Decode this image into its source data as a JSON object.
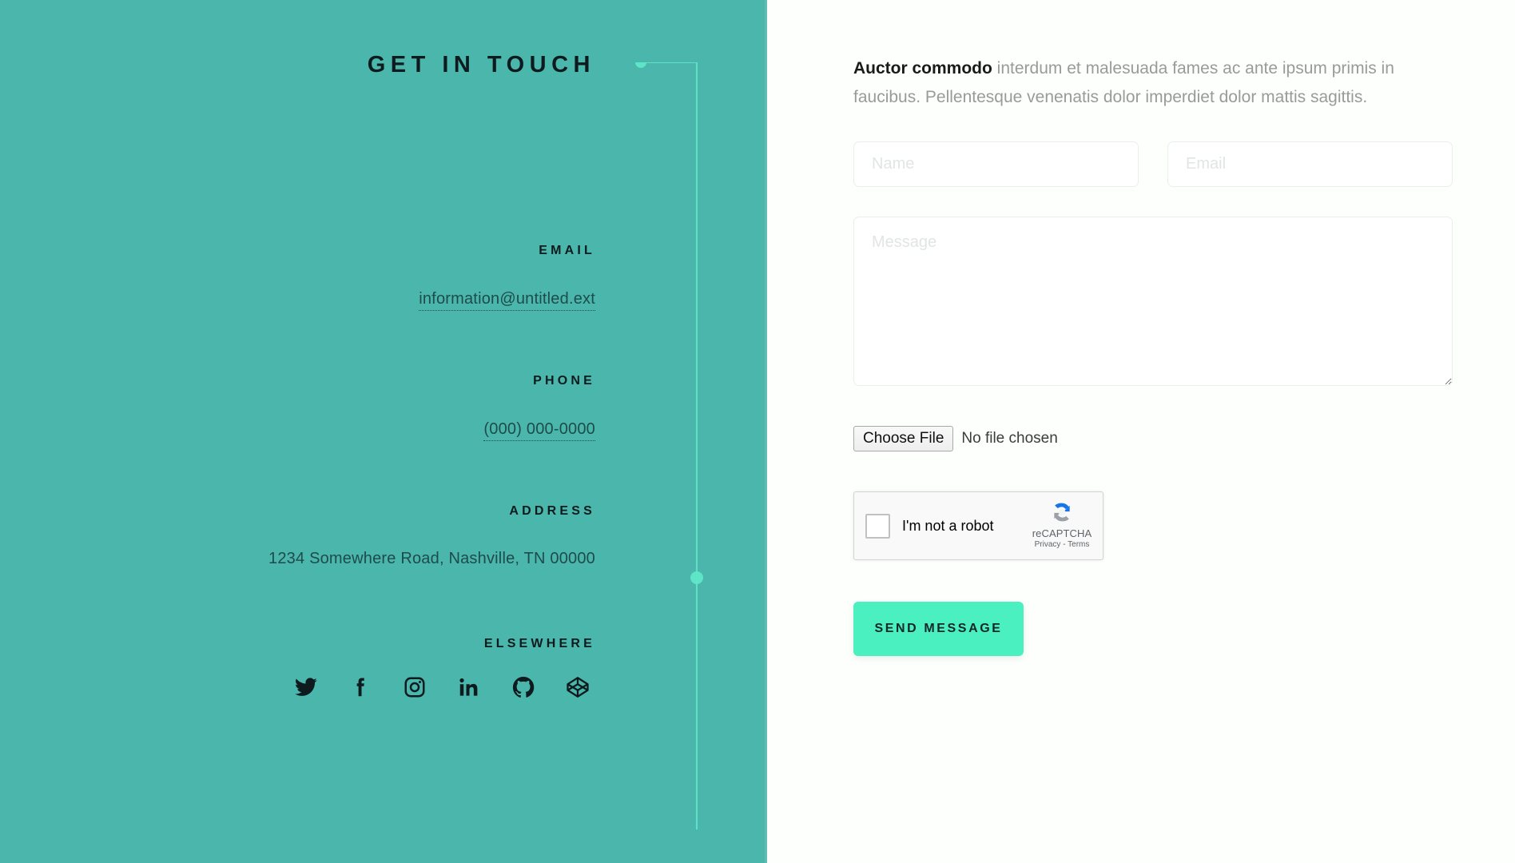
{
  "left": {
    "title": "GET IN TOUCH",
    "sections": [
      {
        "label": "EMAIL",
        "value": "information@untitled.ext",
        "link": true
      },
      {
        "label": "PHONE",
        "value": "(000) 000-0000",
        "link": true
      },
      {
        "label": "ADDRESS",
        "value": "1234 Somewhere Road, Nashville, TN 00000",
        "link": false
      }
    ],
    "elsewhere_label": "ELSEWHERE",
    "social": [
      {
        "name": "twitter-icon"
      },
      {
        "name": "facebook-icon"
      },
      {
        "name": "instagram-icon"
      },
      {
        "name": "linkedin-icon"
      },
      {
        "name": "github-icon"
      },
      {
        "name": "codepen-icon"
      }
    ],
    "background_color": "#4bb7ac",
    "text_color": "#0d1b1e"
  },
  "form": {
    "intro_strong": "Auctor commodo",
    "intro_rest": " interdum et malesuada fames ac ante ipsum primis in faucibus. Pellentesque venenatis dolor imperdiet dolor mattis sagittis.",
    "name_placeholder": "Name",
    "name_value": "",
    "email_placeholder": "Email",
    "email_value": "",
    "message_placeholder": "Message",
    "message_value": "",
    "file_button_label": "Choose File",
    "file_status": "No file chosen",
    "submit_label": "SEND MESSAGE",
    "submit_color": "#4af0bf"
  },
  "recaptcha": {
    "checkbox_label": "I'm not a robot",
    "brand": "reCAPTCHA",
    "links": "Privacy - Terms",
    "logo_blue": "#1a73e8",
    "logo_gray": "#9aa0a6"
  }
}
